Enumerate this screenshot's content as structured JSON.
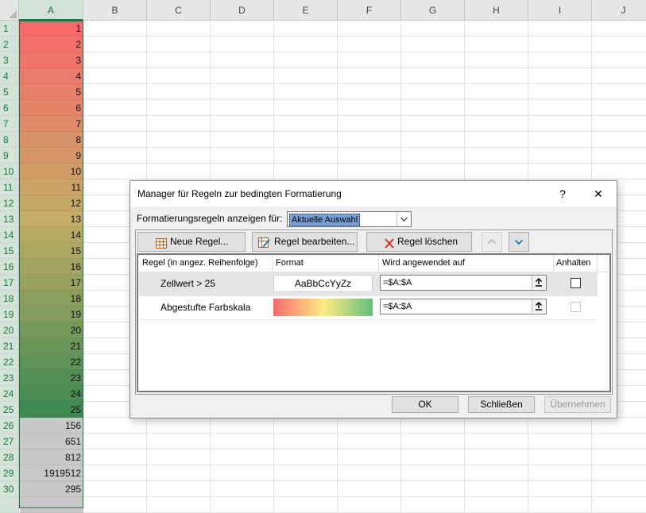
{
  "sheet": {
    "columns": [
      "A",
      "B",
      "C",
      "D",
      "E",
      "F",
      "G",
      "H",
      "I",
      "J"
    ],
    "rows": [
      "1",
      "2",
      "3",
      "4",
      "5",
      "6",
      "7",
      "8",
      "9",
      "10",
      "11",
      "12",
      "13",
      "14",
      "15",
      "16",
      "17",
      "18",
      "19",
      "20",
      "21",
      "22",
      "23",
      "24",
      "25",
      "26",
      "27",
      "28",
      "29",
      "30"
    ],
    "column_a_values": [
      "1",
      "2",
      "3",
      "4",
      "5",
      "6",
      "7",
      "8",
      "9",
      "10",
      "11",
      "12",
      "13",
      "14",
      "15",
      "16",
      "17",
      "18",
      "19",
      "20",
      "21",
      "22",
      "23",
      "24",
      "25",
      "156",
      "651",
      "812",
      "1919512",
      "295",
      ""
    ],
    "selected_column": "A",
    "color_scale": {
      "min_color": "#f8696b",
      "mid_color": "#c3ad67",
      "max_color": "#3e8a52",
      "over_threshold_fill": "#c8c8c8"
    }
  },
  "dialog": {
    "title": "Manager für Regeln zur bedingten Formatierung",
    "help_label": "?",
    "close_label": "✕",
    "show_rules_label": "Formatierungsregeln anzeigen für:",
    "show_rules_value": "Aktuelle Auswahl",
    "buttons": {
      "new_rule": "Neue Regel...",
      "edit_rule": "Regel bearbeiten...",
      "delete_rule": "Regel löschen"
    },
    "columns": {
      "rule": "Regel (in angez. Reihenfolge)",
      "format": "Format",
      "applies_to": "Wird angewendet auf",
      "stop_if_true": "Anhalten"
    },
    "rules": [
      {
        "name": "Zellwert > 25",
        "format_preview": "AaBbCcYyZz",
        "applies_to": "=$A:$A",
        "stop_if_true": false
      },
      {
        "name": "Abgestufte Farbskala",
        "format_preview": "",
        "applies_to": "=$A:$A",
        "stop_if_true": false
      }
    ],
    "footer": {
      "ok": "OK",
      "close": "Schließen",
      "apply": "Übernehmen"
    },
    "accent_color": "#217346"
  }
}
